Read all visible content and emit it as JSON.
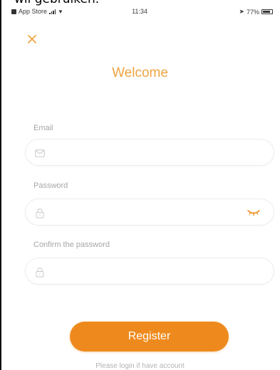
{
  "caption": "wil gebruiken.",
  "status_bar": {
    "carrier": "App Store",
    "time": "11:34",
    "battery": "77%"
  },
  "close_icon": "close-icon",
  "title": "Welcome",
  "fields": {
    "email": {
      "label": "Email",
      "icon": "mail-icon"
    },
    "password": {
      "label": "Password",
      "icon": "lock-icon",
      "toggle_icon": "eye-closed-icon"
    },
    "confirm": {
      "label": "Confirm the password",
      "icon": "lock-icon"
    }
  },
  "register_button": "Register",
  "login_link": "Please login if have account",
  "colors": {
    "accent": "#ee8a1d",
    "title": "#f0a442",
    "label": "#a6a6a6"
  }
}
